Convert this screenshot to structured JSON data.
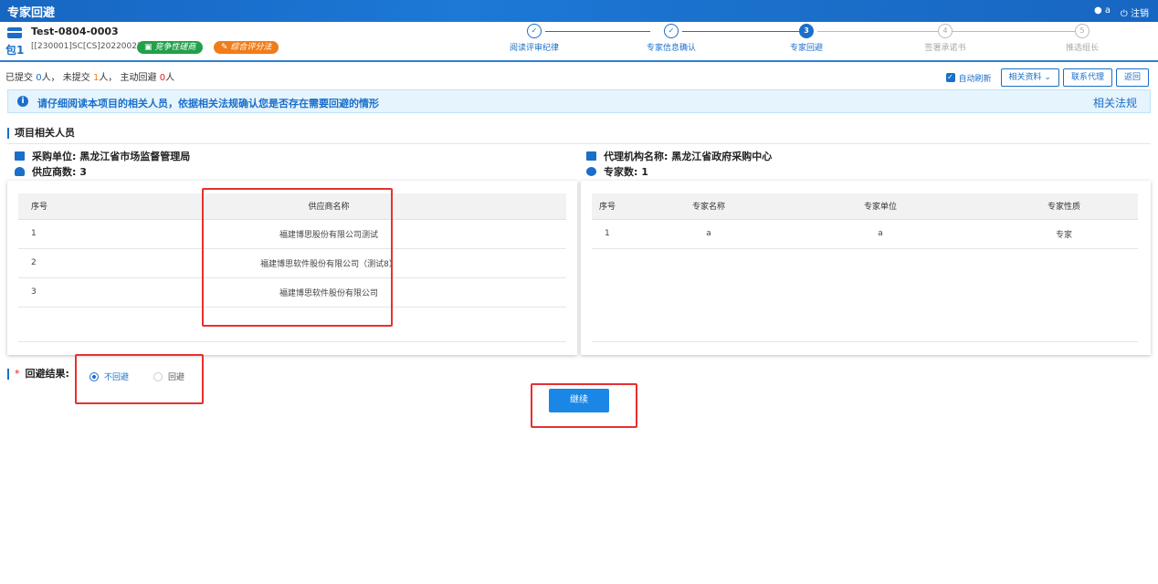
{
  "app": {
    "title": "专家回避"
  },
  "topbar": {
    "user": "a",
    "logout": "注销"
  },
  "project": {
    "package": "包1",
    "name": "Test-0804-0003",
    "code": "[[230001]SC[CS]20220027 ]",
    "badge_green": "竞争性磋商",
    "badge_orange": "综合评分法"
  },
  "steps": [
    {
      "num": "",
      "label": "阅读评审纪律",
      "state": "done"
    },
    {
      "num": "",
      "label": "专家信息确认",
      "state": "done"
    },
    {
      "num": "3",
      "label": "专家回避",
      "state": "active"
    },
    {
      "num": "4",
      "label": "签署承诺书",
      "state": "todo"
    },
    {
      "num": "5",
      "label": "推选组长",
      "state": "todo"
    }
  ],
  "summary": {
    "submitted_prefix": "已提交",
    "submitted_count": "0",
    "submitted_unit": "人，",
    "unsubmitted_prefix": "未提交",
    "unsubmitted_count": "1",
    "unsubmitted_unit": "人，",
    "avoid_prefix": "主动回避",
    "avoid_count": "0",
    "avoid_unit": "人"
  },
  "toolbar": {
    "auto_refresh": "自动刷新",
    "materials": "相关资料",
    "contact": "联系代理",
    "back": "返回"
  },
  "notice": {
    "message": "请仔细阅读本项目的相关人员，依据相关法规确认您是否存在需要回避的情形",
    "law_link": "相关法规"
  },
  "section": {
    "title": "项目相关人员"
  },
  "info": {
    "purchaser_label": "采购单位:",
    "purchaser_value": "黑龙江省市场监督管理局",
    "supplier_count_label": "供应商数:",
    "supplier_count_value": "3",
    "agency_label": "代理机构名称:",
    "agency_value": "黑龙江省政府采购中心",
    "expert_count_label": "专家数:",
    "expert_count_value": "1"
  },
  "supplier_table": {
    "headers": [
      "序号",
      "供应商名称"
    ],
    "rows": [
      [
        "1",
        "福建博思股份有限公司测试"
      ],
      [
        "2",
        "福建博思软件股份有限公司（测试8）"
      ],
      [
        "3",
        "福建博思软件股份有限公司"
      ]
    ]
  },
  "expert_table": {
    "headers": [
      "序号",
      "专家名称",
      "专家单位",
      "专家性质"
    ],
    "rows": [
      [
        "1",
        "a",
        "a",
        "专家"
      ]
    ]
  },
  "result": {
    "label": "回避结果:",
    "option_no": "不回避",
    "option_yes": "回避",
    "selected": "不回避"
  },
  "continue_button": "继续",
  "colors": {
    "primary": "#1a6fc9",
    "highlight": "#e83030"
  }
}
